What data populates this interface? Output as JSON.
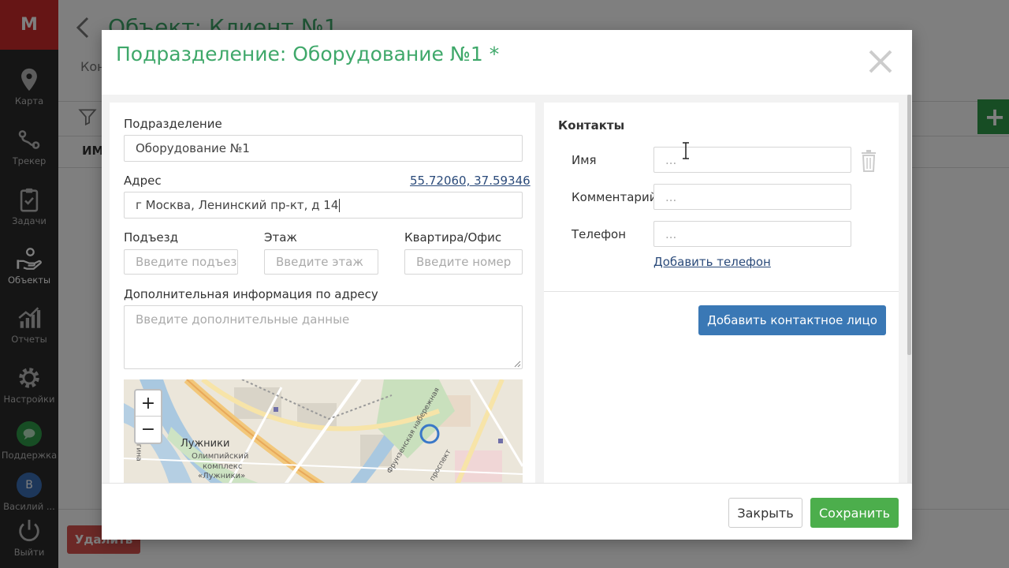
{
  "app": {
    "logo": "M",
    "nav": [
      {
        "label": "Карта",
        "icon": "map-pin-icon"
      },
      {
        "label": "Трекер",
        "icon": "route-icon"
      },
      {
        "label": "Задачи",
        "icon": "clipboard-icon"
      },
      {
        "label": "Объекты",
        "icon": "hand-objects-icon",
        "active": true
      },
      {
        "label": "Отчеты",
        "icon": "chart-icon"
      },
      {
        "label": "Настройки",
        "icon": "gear-icon"
      },
      {
        "label": "Поддержка",
        "icon": "chat-icon"
      },
      {
        "label": "Василий ...",
        "icon": "user-avatar",
        "avatar_letter": "В"
      },
      {
        "label": "Выйти",
        "icon": "power-icon"
      }
    ]
  },
  "background": {
    "title": "Объект: Клиент №1",
    "tab_partial": "Кон",
    "column_partial": "ИМ",
    "add_label": "+",
    "delete_label": "Удалить"
  },
  "modal": {
    "title": "Подразделение: Оборудование №1 *",
    "left": {
      "division_label": "Подразделение",
      "division_value": "Оборудование №1",
      "address_label": "Адрес",
      "coordinates": "55.72060, 37.59346",
      "address_value": "г Москва, Ленинский пр-кт, д 14",
      "entrance_label": "Подъезд",
      "entrance_placeholder": "Введите подъезд",
      "floor_label": "Этаж",
      "floor_placeholder": "Введите этаж",
      "office_label": "Квартира/Офис",
      "office_placeholder": "Введите номер",
      "extra_label": "Дополнительная информация по адресу",
      "extra_placeholder": "Введите дополнительные данные",
      "map": {
        "zoom_in": "+",
        "zoom_out": "−",
        "labels": [
          "Лужники",
          "Олимпийский",
          "комплекс",
          "«Лужники»",
          "улица Косыгина",
          "Фрунзенская набережная",
          "проспект"
        ]
      }
    },
    "right": {
      "section_title": "Контакты",
      "name_label": "Имя",
      "name_placeholder": "...",
      "comment_label": "Комментарий",
      "comment_placeholder": "...",
      "phone_label": "Телефон",
      "phone_placeholder": "...",
      "add_phone": "Добавить телефон",
      "add_contact": "Добавить контактное лицо"
    },
    "footer": {
      "close": "Закрыть",
      "save": "Сохранить"
    }
  }
}
